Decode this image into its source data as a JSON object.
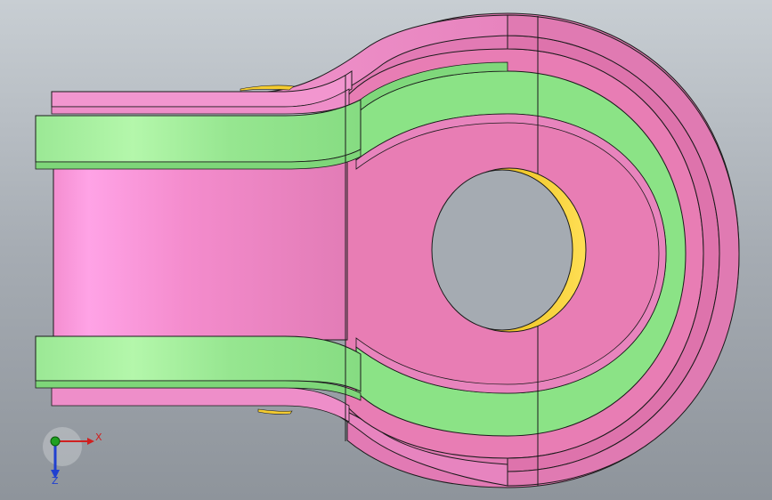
{
  "viewport": {
    "background_top": "#c4cacf",
    "background_mid": "#a3a9b0",
    "background_bottom": "#8f959c"
  },
  "model": {
    "colors": {
      "body_pink": "#e87db4",
      "body_pink_light": "#ff9ee0",
      "body_pink_dark": "#d86aa2",
      "flange_green": "#8fe08a",
      "flange_green_light": "#b2f5a8",
      "bore_yellow": "#f5cc30",
      "edge": "#1a1a1a"
    }
  },
  "triad": {
    "x_label": "X",
    "z_label": "Z",
    "x_color": "#d02020",
    "y_color": "#20a020",
    "z_color": "#2040d0"
  }
}
